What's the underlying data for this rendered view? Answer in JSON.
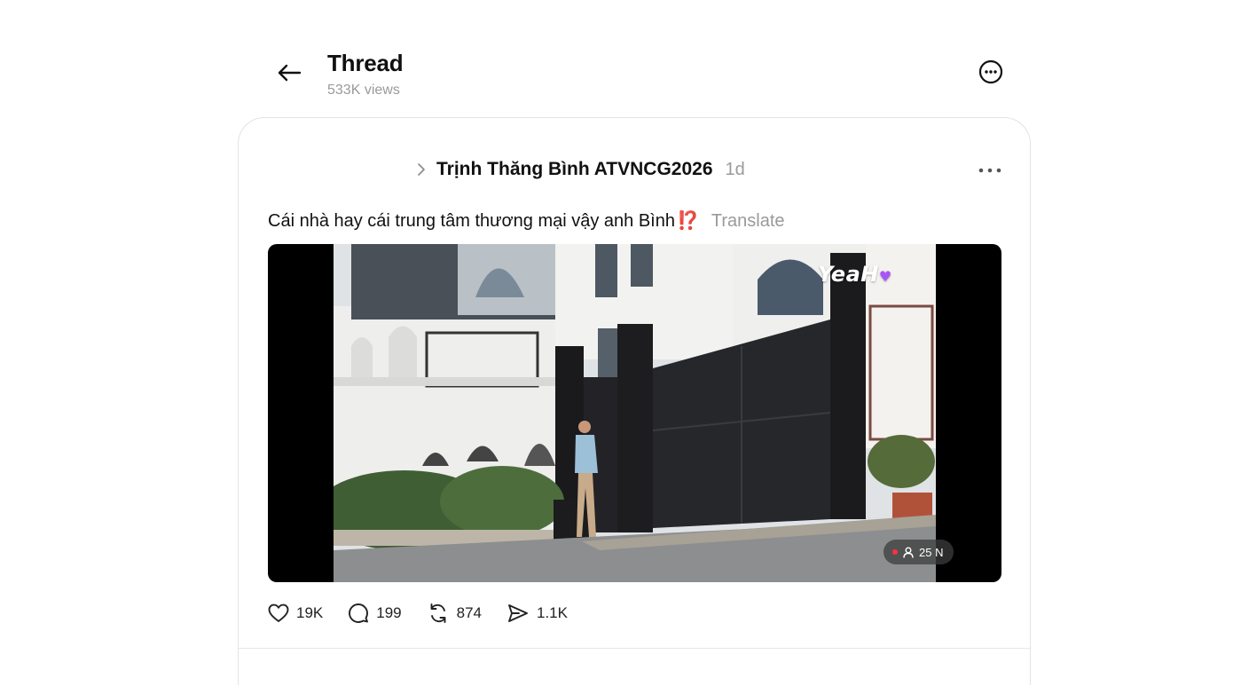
{
  "header": {
    "title": "Thread",
    "views": "533K views",
    "back_icon": "arrow-left-icon",
    "more_icon": "more-circle-icon"
  },
  "post": {
    "author": "Trịnh Thăng Bình ATVNCG2026",
    "time": "1d",
    "text": "Cái nhà hay cái trung tâm thương mại vậy anh Bình",
    "emoji": "⁉️",
    "translate_label": "Translate",
    "video": {
      "watermark": "YeaH",
      "viewers": "25 N"
    },
    "actions": {
      "likes": "19K",
      "replies": "199",
      "reposts": "874",
      "shares": "1.1K"
    }
  },
  "colors": {
    "text": "#101010",
    "muted": "#9a9a9a",
    "border": "#e3e3e3",
    "live": "#ff3040"
  }
}
